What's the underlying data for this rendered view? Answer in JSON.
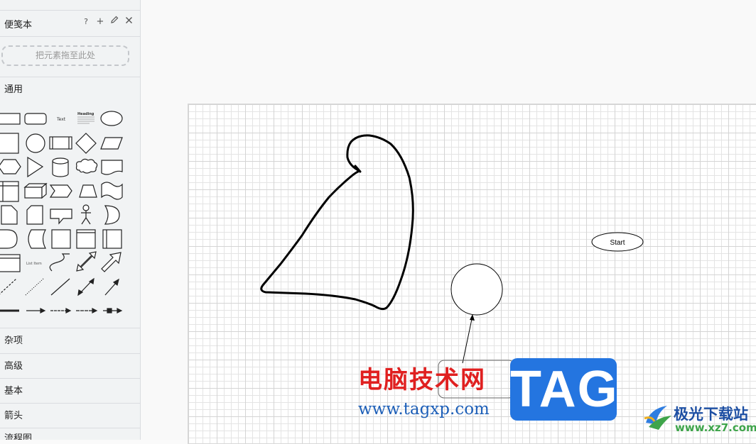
{
  "sidebar": {
    "scratchpad": {
      "title": "便笺本",
      "help_icon": "question-mark-icon",
      "add_icon": "plus-icon",
      "edit_icon": "pencil-icon",
      "close_icon": "close-icon",
      "drop_text": "把元素拖至此处"
    },
    "general_label": "通用",
    "palette_text_labels": {
      "text": "Text",
      "heading": "Heading",
      "list_item": "List Item"
    },
    "sections": [
      "杂项",
      "高级",
      "基本",
      "箭头",
      "流程图"
    ]
  },
  "canvas": {
    "start_label": "Start"
  },
  "watermark": {
    "cn_text": "电脑技术网",
    "url": "www.tagxp.com",
    "tag": "TAG",
    "logo_text": "极光下载站",
    "logo_url": "www.xz7.com"
  },
  "colors": {
    "watermark_red": "#e02020",
    "watermark_blue": "#2475e0",
    "accent_green": "#3ea44a"
  }
}
